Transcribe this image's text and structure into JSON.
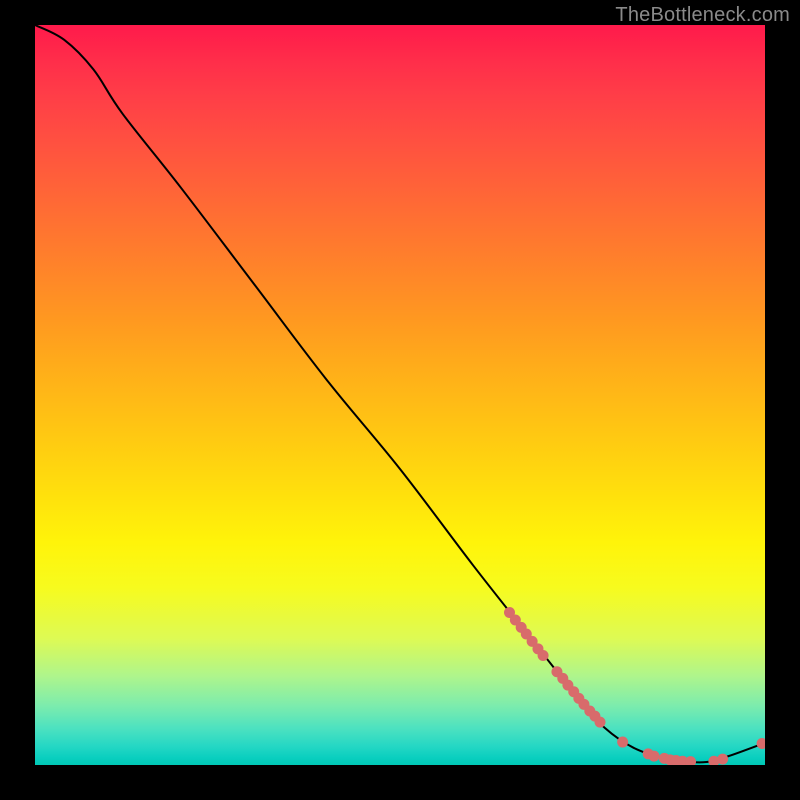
{
  "watermark": "TheBottleneck.com",
  "colors": {
    "gradient_top": "#ff1a4b",
    "gradient_bottom": "#00c9b6",
    "line": "#000000",
    "dot": "#d86b6b",
    "page_bg": "#000000"
  },
  "chart_data": {
    "type": "line",
    "title": "",
    "xlabel": "",
    "ylabel": "",
    "xlim": [
      0,
      100
    ],
    "ylim": [
      0,
      100
    ],
    "grid": false,
    "legend": false,
    "series": [
      {
        "name": "bottleneck-curve",
        "x": [
          0,
          4,
          8,
          12,
          20,
          30,
          40,
          50,
          60,
          68,
          72,
          76,
          80,
          84,
          88,
          92,
          95,
          100
        ],
        "values": [
          100,
          98,
          94,
          88,
          78,
          65,
          52,
          40,
          27,
          17,
          12,
          7,
          3.5,
          1.5,
          0.6,
          0.4,
          1.2,
          3
        ]
      }
    ],
    "markers": [
      {
        "x": 65.0,
        "y": 20.6
      },
      {
        "x": 65.8,
        "y": 19.6
      },
      {
        "x": 66.6,
        "y": 18.6
      },
      {
        "x": 67.3,
        "y": 17.7
      },
      {
        "x": 68.1,
        "y": 16.7
      },
      {
        "x": 68.9,
        "y": 15.7
      },
      {
        "x": 69.6,
        "y": 14.8
      },
      {
        "x": 71.5,
        "y": 12.6
      },
      {
        "x": 72.3,
        "y": 11.7
      },
      {
        "x": 73.0,
        "y": 10.8
      },
      {
        "x": 73.8,
        "y": 9.9
      },
      {
        "x": 74.5,
        "y": 9.0
      },
      {
        "x": 75.2,
        "y": 8.2
      },
      {
        "x": 76.0,
        "y": 7.3
      },
      {
        "x": 76.7,
        "y": 6.6
      },
      {
        "x": 77.4,
        "y": 5.8
      },
      {
        "x": 80.5,
        "y": 3.1
      },
      {
        "x": 84.0,
        "y": 1.5
      },
      {
        "x": 84.8,
        "y": 1.2
      },
      {
        "x": 86.2,
        "y": 0.9
      },
      {
        "x": 87.0,
        "y": 0.7
      },
      {
        "x": 87.8,
        "y": 0.6
      },
      {
        "x": 88.7,
        "y": 0.5
      },
      {
        "x": 89.8,
        "y": 0.45
      },
      {
        "x": 93.0,
        "y": 0.5
      },
      {
        "x": 94.2,
        "y": 0.8
      },
      {
        "x": 99.6,
        "y": 2.9
      }
    ]
  }
}
